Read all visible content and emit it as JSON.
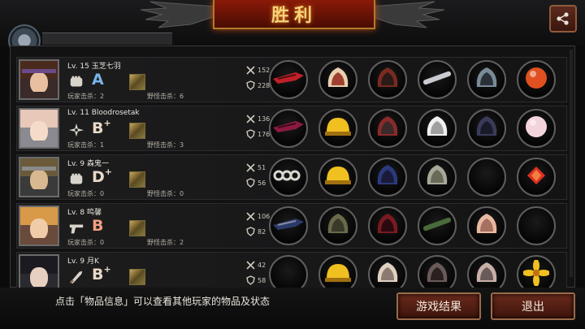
{
  "header": {
    "title": "胜利",
    "share_icon": "share-icon"
  },
  "players": [
    {
      "level": "Lv. 15",
      "name": "玉芝七羽",
      "grade": "A",
      "grade_plus": "",
      "grade_color": "#7ab3e8",
      "kills": "玩家击杀：2",
      "wild_kills": "野怪击杀：6",
      "attack": "152",
      "defense": "228",
      "weapon_icon": "fist-icon"
    },
    {
      "level": "Lv. 11",
      "name": "Bloodrosetak",
      "grade": "B",
      "grade_plus": "+",
      "grade_color": "#e8d8c8",
      "kills": "玩家击杀：1",
      "wild_kills": "野怪击杀：3",
      "attack": "136",
      "defense": "176",
      "weapon_icon": "shuriken-icon"
    },
    {
      "level": "Lv. 9",
      "name": "森鬼一",
      "grade": "D",
      "grade_plus": "+",
      "grade_color": "#e8d8c8",
      "kills": "玩家击杀：0",
      "wild_kills": "野怪击杀：0",
      "attack": "51",
      "defense": "56",
      "weapon_icon": "fist-icon"
    },
    {
      "level": "Lv. 8",
      "name": "鸣馨",
      "grade": "B",
      "grade_plus": "",
      "grade_color": "#f0a080",
      "kills": "玩家击杀：0",
      "wild_kills": "野怪击杀：2",
      "attack": "106",
      "defense": "82",
      "weapon_icon": "pistol-icon"
    },
    {
      "level": "Lv. 9",
      "name": "月K",
      "grade": "B",
      "grade_plus": "+",
      "grade_color": "#e8d8c8",
      "kills": "",
      "wild_kills": "",
      "attack": "42",
      "defense": "58",
      "weapon_icon": "knife-icon"
    }
  ],
  "footer": {
    "hint": "点击「物品信息」可以查看其他玩家的物品及状态",
    "result_button": "游戏结果",
    "exit_button": "退出"
  }
}
